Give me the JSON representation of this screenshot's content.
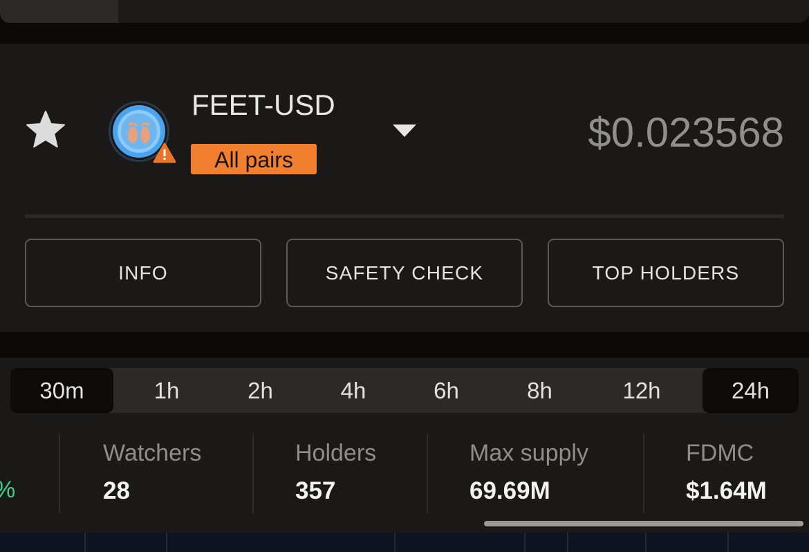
{
  "pair": {
    "title": "FEET-USD",
    "all_pairs_label": "All pairs",
    "price": "$0.023568",
    "logo_icon": "feet-token-icon",
    "warning_icon": "warning-triangle-icon",
    "favorite_icon": "star-icon",
    "dropdown_icon": "caret-down-icon"
  },
  "actions": [
    {
      "label": "INFO"
    },
    {
      "label": "SAFETY CHECK"
    },
    {
      "label": "TOP HOLDERS"
    }
  ],
  "timeframes": {
    "items": [
      "30m",
      "1h",
      "2h",
      "4h",
      "6h",
      "8h",
      "12h",
      "24h"
    ],
    "active": [
      "30m",
      "24h"
    ]
  },
  "stats": {
    "truncated_change": "%",
    "items": [
      {
        "label": "Watchers",
        "value": "28"
      },
      {
        "label": "Holders",
        "value": "357"
      },
      {
        "label": "Max supply",
        "value": "69.69M"
      },
      {
        "label": "FDMC",
        "value": "$1.64M"
      }
    ]
  },
  "colors": {
    "accent_orange": "#f0802f",
    "price_gray": "#8f8f8f",
    "positive_green": "#3fcf8e",
    "panel_bg": "#1a1918"
  }
}
